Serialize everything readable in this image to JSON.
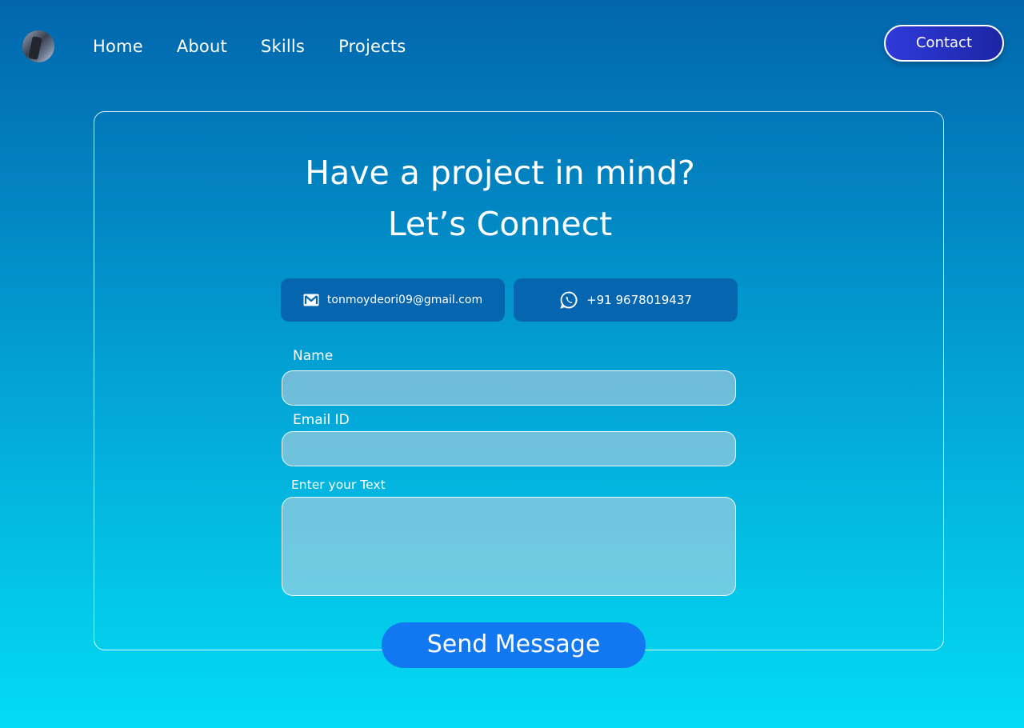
{
  "nav": {
    "avatar_alt": "profile avatar",
    "items": [
      {
        "label": "Home"
      },
      {
        "label": "About"
      },
      {
        "label": "Skills"
      },
      {
        "label": "Projects"
      }
    ],
    "contact_label": "Contact"
  },
  "hero": {
    "line1": "Have a  project in mind?",
    "line2": "Let’s Connect"
  },
  "contact_chips": {
    "email": "tonmoydeori09@gmail.com",
    "email_icon": "mail-icon",
    "phone": "+91  9678019437",
    "phone_icon": "whatsapp-icon"
  },
  "form": {
    "name_label": "Name",
    "name_value": "",
    "email_label": "Email ID",
    "email_value": "",
    "text_label": "Enter your  Text",
    "text_value": "",
    "send_label": "Send Message"
  },
  "colors": {
    "bg_top": "#0266ad",
    "bg_bottom": "#03dcf3",
    "contact_button": "#2f3ad9",
    "chip": "#0565ae",
    "send_button": "#1178f2"
  }
}
